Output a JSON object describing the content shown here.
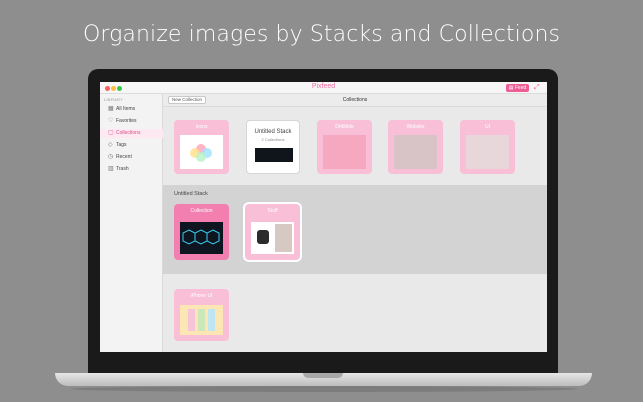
{
  "headline": "Organize images by Stacks and Collections",
  "app": {
    "title": "Pixfeed",
    "feed_button": "Feed"
  },
  "sidebar": {
    "header": "LIBRARY",
    "items": [
      {
        "label": "All Items",
        "icon": "grid-icon"
      },
      {
        "label": "Favorites",
        "icon": "heart-icon"
      },
      {
        "label": "Collections",
        "icon": "collection-icon",
        "active": true
      },
      {
        "label": "Tags",
        "icon": "tag-icon"
      },
      {
        "label": "Recent",
        "icon": "clock-icon"
      },
      {
        "label": "Trash",
        "icon": "trash-icon"
      }
    ]
  },
  "toolbar": {
    "new_collection": "New Collection",
    "title": "Collections"
  },
  "top_row": [
    {
      "label": "Icons",
      "type": "collection"
    },
    {
      "label": "Untitled Stack",
      "sub": "2 Collections",
      "type": "stack"
    },
    {
      "label": "Dribbble",
      "type": "collection"
    },
    {
      "label": "Website",
      "type": "collection"
    },
    {
      "label": "UI",
      "type": "collection"
    }
  ],
  "stack_panel": {
    "label": "Untitled Stack",
    "items": [
      {
        "label": "Collection"
      },
      {
        "label": "Stuff"
      }
    ]
  },
  "bottom_row": [
    {
      "label": "iPhone UI"
    }
  ],
  "colors": {
    "accent": "#ec5e95",
    "card_pink": "#f9bfd6",
    "card_pink_strong": "#f27fb0",
    "background": "#8e8e8e"
  }
}
